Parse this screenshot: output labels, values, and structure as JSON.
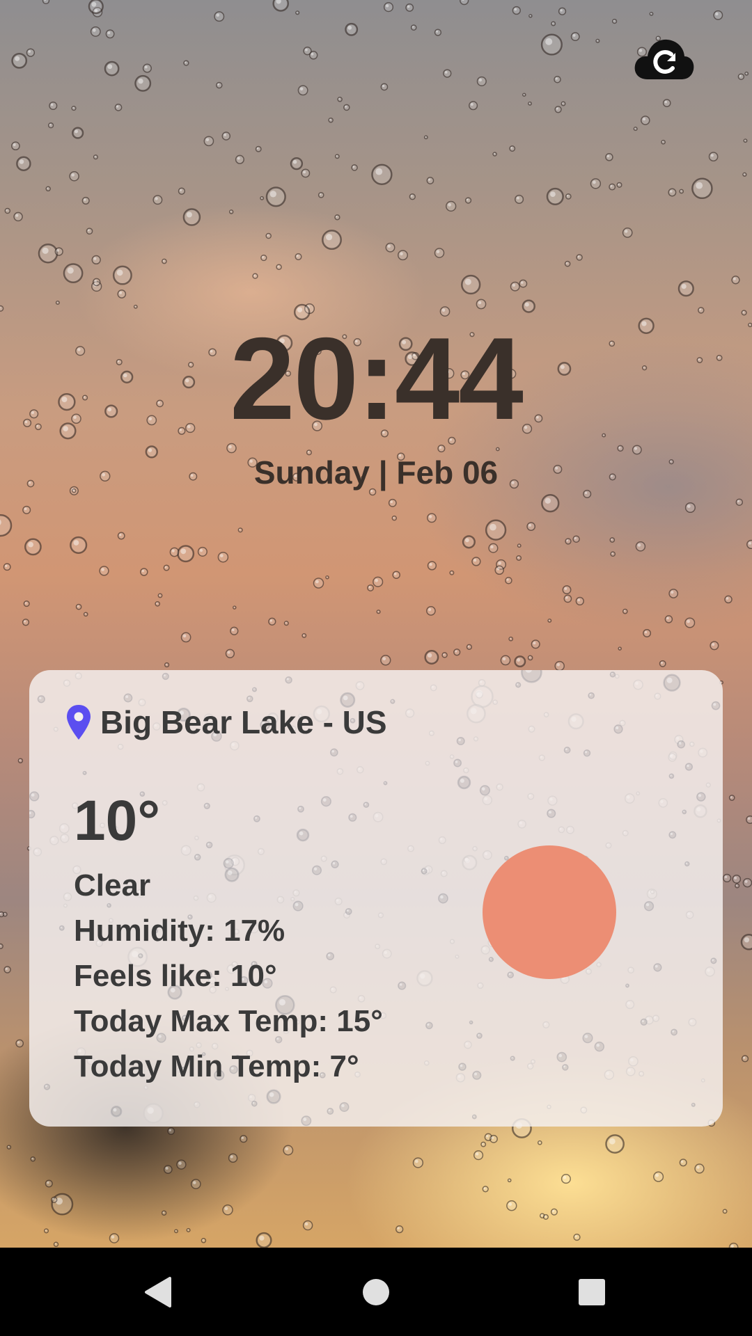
{
  "app": {
    "sync_icon": "cloud-sync-icon"
  },
  "clock": {
    "time": "20:44",
    "date": "Sunday | Feb 06"
  },
  "weather": {
    "location_icon": "location-pin-icon",
    "location": "Big Bear Lake - US",
    "temperature": "10°",
    "condition": "Clear",
    "humidity": "Humidity: 17%",
    "feels_like": "Feels like: 10°",
    "max_temp": "Today Max Temp: 15°",
    "min_temp": "Today Min Temp: 7°",
    "condition_icon": "sun-icon"
  },
  "navigation": {
    "back_icon": "back-triangle-icon",
    "home_icon": "home-circle-icon",
    "recents_icon": "recents-square-icon"
  },
  "colors": {
    "pin": "#5b4ef0",
    "sun": "#ec8e74",
    "text_dark": "#3a302a",
    "card_text": "#3a3a3a",
    "nav_icons": "#e0e0e0"
  }
}
